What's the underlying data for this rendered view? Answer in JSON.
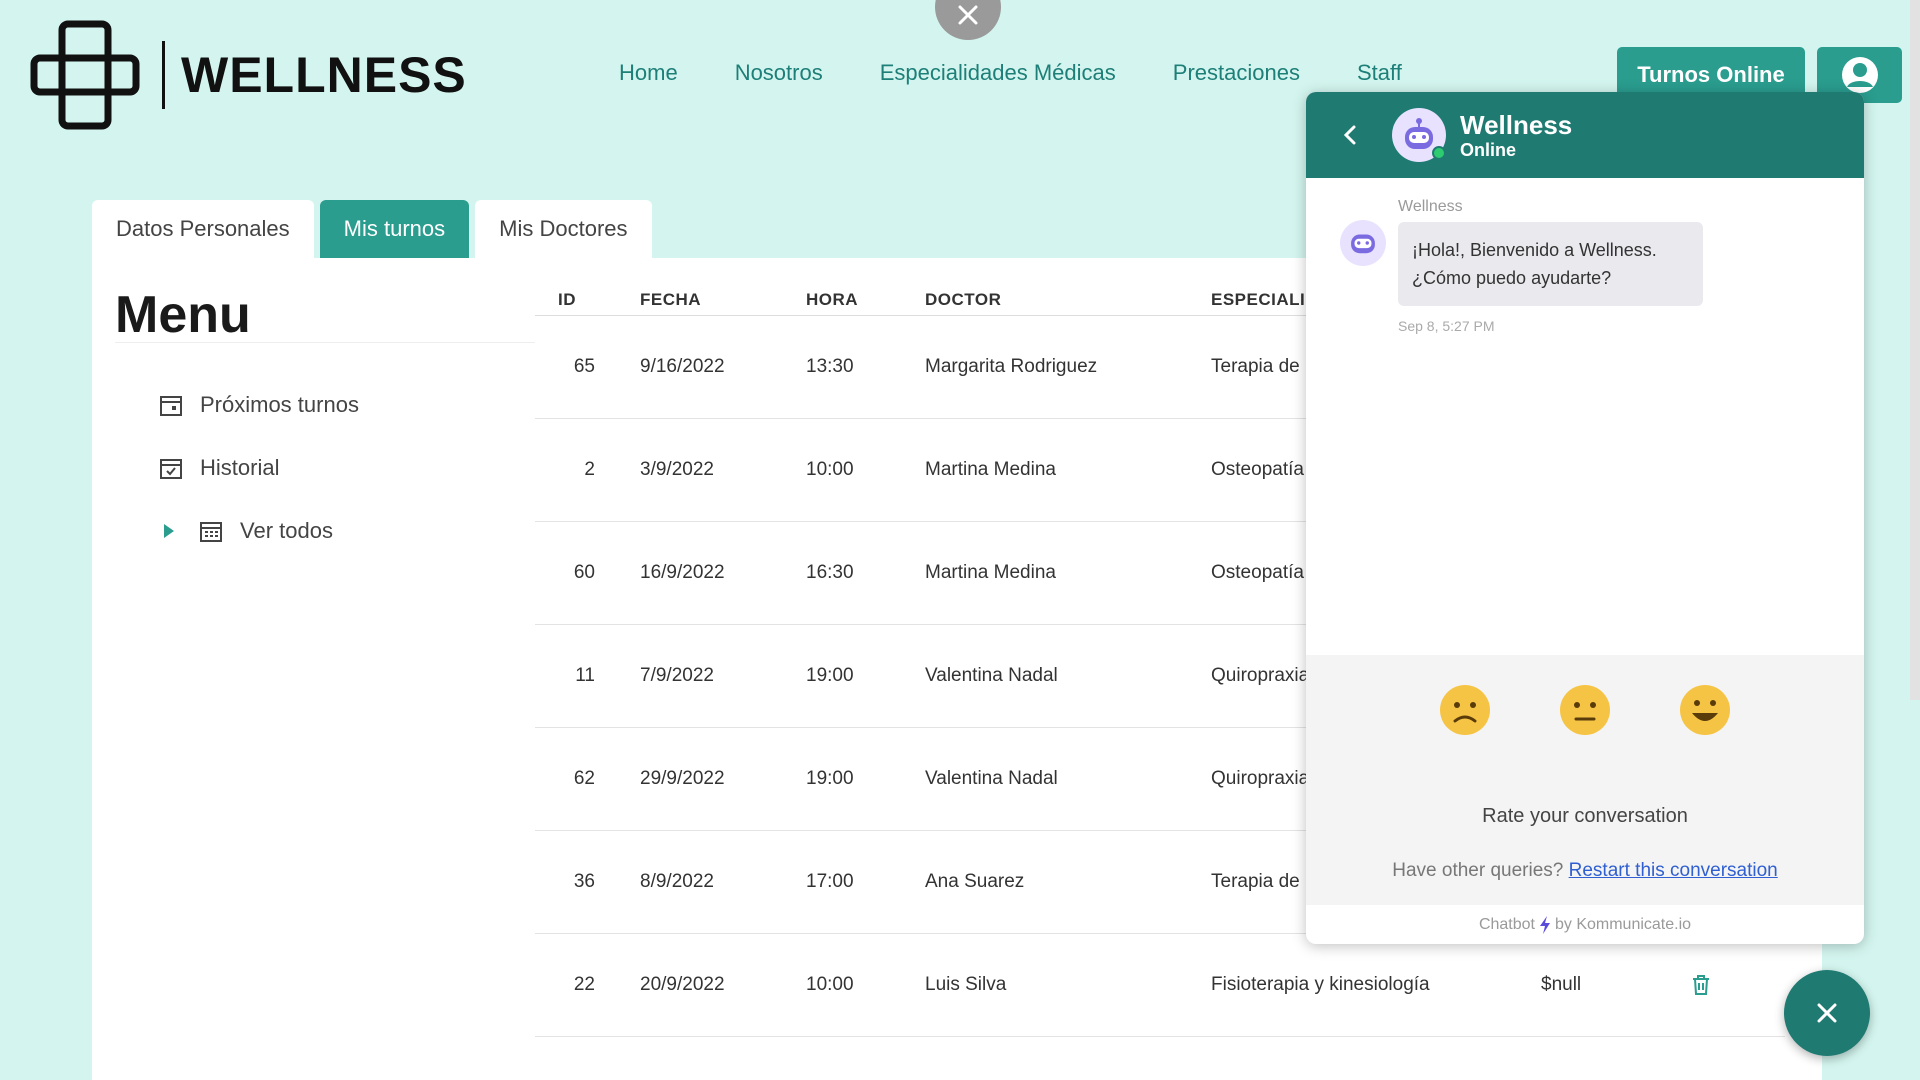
{
  "brand": {
    "name": "WELLNESS",
    "logo_icon": "medical-cross-icon"
  },
  "nav": {
    "items": [
      "Home",
      "Nosotros",
      "Especialidades Médicas",
      "Prestaciones",
      "Staff"
    ],
    "turnos_button": "Turnos Online",
    "user_icon": "user-circle-icon"
  },
  "tabs": [
    {
      "label": "Datos Personales",
      "active": false
    },
    {
      "label": "Mis turnos",
      "active": true
    },
    {
      "label": "Mis Doctores",
      "active": false
    }
  ],
  "menu": {
    "title": "Menu",
    "items": [
      {
        "label": "Próximos turnos",
        "icon": "calendar-icon"
      },
      {
        "label": "Historial",
        "icon": "calendar-check-icon"
      },
      {
        "label": "Ver todos",
        "icon": "calendar-grid-icon"
      }
    ]
  },
  "table": {
    "headers": [
      "ID",
      "FECHA",
      "HORA",
      "DOCTOR",
      "ESPECIALID"
    ],
    "rows": [
      {
        "id": "65",
        "fecha": "9/16/2022",
        "hora": "13:30",
        "doctor": "Margarita Rodriguez",
        "especialidad": "Terapia de"
      },
      {
        "id": "2",
        "fecha": "3/9/2022",
        "hora": "10:00",
        "doctor": "Martina Medina",
        "especialidad": "Osteopatía"
      },
      {
        "id": "60",
        "fecha": "16/9/2022",
        "hora": "16:30",
        "doctor": "Martina Medina",
        "especialidad": "Osteopatía"
      },
      {
        "id": "11",
        "fecha": "7/9/2022",
        "hora": "19:00",
        "doctor": "Valentina Nadal",
        "especialidad": "Quiropraxia"
      },
      {
        "id": "62",
        "fecha": "29/9/2022",
        "hora": "19:00",
        "doctor": "Valentina Nadal",
        "especialidad": "Quiropraxia"
      },
      {
        "id": "36",
        "fecha": "8/9/2022",
        "hora": "17:00",
        "doctor": "Ana Suarez",
        "especialidad": "Terapia de"
      },
      {
        "id": "22",
        "fecha": "20/9/2022",
        "hora": "10:00",
        "doctor": "Luis Silva",
        "especialidad": "Fisioterapia y kinesiología",
        "precio": "$null"
      }
    ]
  },
  "chat": {
    "bot_name": "Wellness",
    "status": "Online",
    "sender": "Wellness",
    "message_line1": "¡Hola!, Bienvenido a Wellness.",
    "message_line2": "¿Cómo puedo ayudarte?",
    "time": "Sep 8, 5:27 PM",
    "rate_text": "Rate your conversation",
    "queries_text": "Have other queries?",
    "restart_link": "Restart this conversation",
    "powered_prefix": "Chatbot",
    "powered_suffix": "by Kommunicate.io"
  },
  "colors": {
    "primary": "#2a9d8f",
    "dark_teal": "#1f7a72",
    "background": "#d4f5ef",
    "accent_link": "#2f5fd0"
  }
}
